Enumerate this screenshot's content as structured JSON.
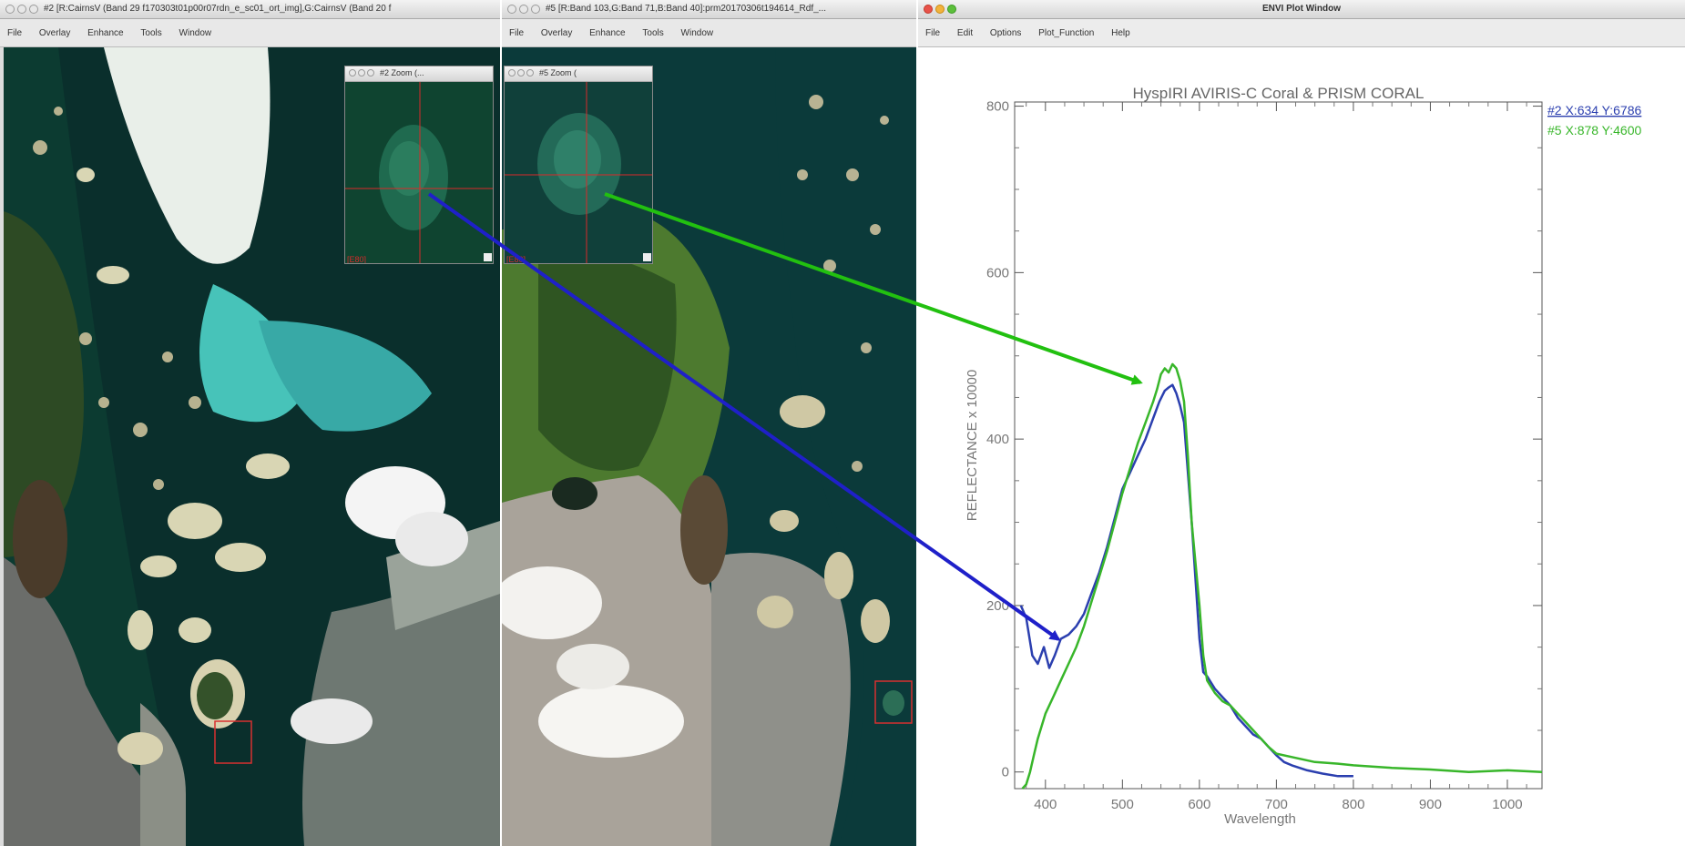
{
  "win_left": {
    "title": "#2 [R:CairnsV (Band 29 f170303t01p00r07rdn_e_sc01_ort_img],G:CairnsV (Band 20 f",
    "menu": [
      "File",
      "Overlay",
      "Enhance",
      "Tools",
      "Window"
    ]
  },
  "zoom_left": {
    "title": "#2 Zoom (...",
    "marker": "[E80]"
  },
  "win_mid": {
    "title": "#5 [R:Band 103,G:Band 71,B:Band 40]:prm20170306t194614_Rdf_...",
    "menu": [
      "File",
      "Overlay",
      "Enhance",
      "Tools",
      "Window"
    ]
  },
  "zoom_mid": {
    "title": "#5 Zoom (",
    "marker": "[E80]"
  },
  "plot": {
    "title": "ENVI Plot Window",
    "menu": [
      "File",
      "Edit",
      "Options",
      "Plot_Function",
      "Help"
    ]
  },
  "chart_data": {
    "type": "line",
    "title": "HyspIRI AVIRIS-C Coral & PRISM CORAL",
    "xlabel": "Wavelength",
    "ylabel": "REFLECTANCE x 10000",
    "xlim": [
      360,
      1045
    ],
    "ylim": [
      -20,
      805
    ],
    "xticks": [
      400,
      500,
      600,
      700,
      800,
      900,
      1000
    ],
    "yticks": [
      0,
      200,
      400,
      600,
      800
    ],
    "legend_position": "top-right",
    "series": [
      {
        "name": "#2 X:634 Y:6786",
        "color": "#2b3faf",
        "x": [
          368,
          375,
          383,
          390,
          398,
          405,
          412,
          420,
          430,
          440,
          450,
          460,
          470,
          480,
          490,
          500,
          510,
          520,
          530,
          540,
          548,
          555,
          560,
          565,
          570,
          575,
          580,
          590,
          600,
          605,
          610,
          620,
          630,
          640,
          650,
          660,
          670,
          680,
          690,
          700,
          710,
          720,
          740,
          760,
          780,
          800
        ],
        "y": [
          200,
          185,
          140,
          130,
          150,
          125,
          140,
          160,
          165,
          175,
          190,
          215,
          240,
          270,
          305,
          340,
          360,
          380,
          400,
          425,
          445,
          458,
          462,
          465,
          455,
          440,
          420,
          300,
          160,
          120,
          115,
          100,
          90,
          80,
          65,
          55,
          45,
          40,
          30,
          20,
          12,
          8,
          2,
          -2,
          -5,
          -5
        ]
      },
      {
        "name": "#5 X:878 Y:4600",
        "color": "#38b62a",
        "x": [
          370,
          375,
          380,
          385,
          390,
          395,
          400,
          410,
          420,
          430,
          440,
          450,
          460,
          470,
          480,
          490,
          500,
          510,
          520,
          530,
          540,
          545,
          550,
          555,
          560,
          565,
          570,
          575,
          580,
          585,
          590,
          600,
          605,
          610,
          620,
          630,
          640,
          650,
          660,
          670,
          680,
          690,
          700,
          720,
          750,
          780,
          800,
          850,
          900,
          950,
          1000,
          1045
        ],
        "y": [
          -20,
          -15,
          0,
          20,
          40,
          55,
          70,
          90,
          110,
          130,
          150,
          175,
          205,
          235,
          265,
          300,
          335,
          365,
          395,
          420,
          445,
          460,
          478,
          485,
          480,
          490,
          485,
          470,
          445,
          380,
          300,
          200,
          140,
          110,
          95,
          85,
          80,
          70,
          60,
          50,
          40,
          30,
          22,
          18,
          12,
          10,
          8,
          5,
          3,
          0,
          2,
          0
        ]
      }
    ]
  }
}
